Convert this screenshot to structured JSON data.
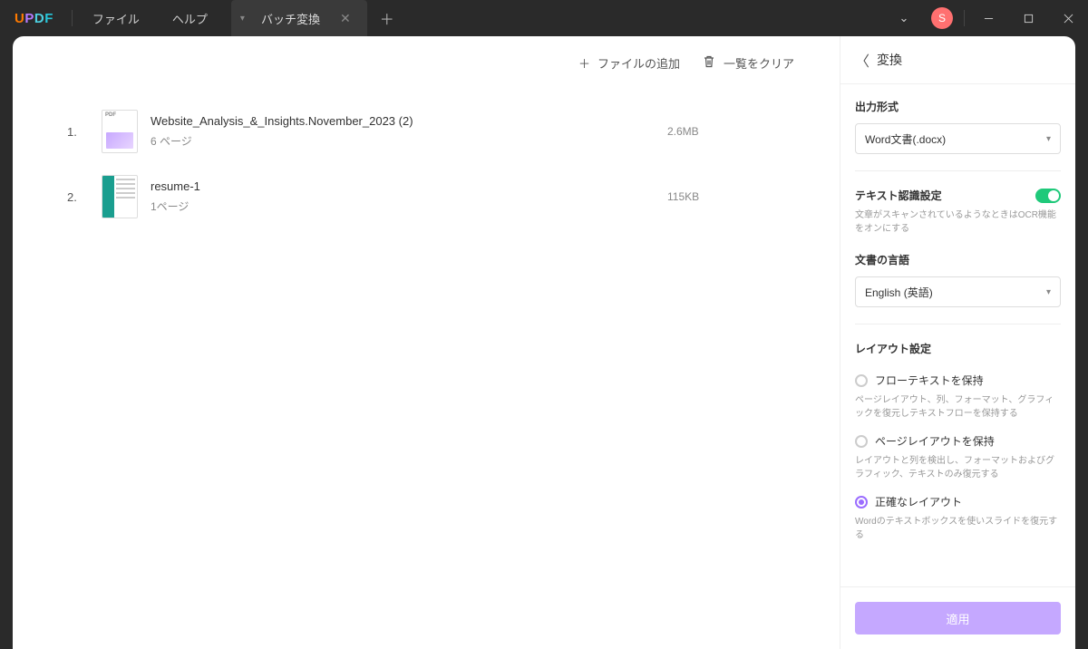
{
  "menu": {
    "file": "ファイル",
    "help": "ヘルプ"
  },
  "tab": {
    "title": "バッチ変換"
  },
  "avatar": "S",
  "toolbar": {
    "add_files": "ファイルの追加",
    "clear_list": "一覧をクリア"
  },
  "files": [
    {
      "idx": "1.",
      "name": "Website_Analysis_&_Insights.November_2023 (2)",
      "pages": "6 ページ",
      "size": "2.6MB"
    },
    {
      "idx": "2.",
      "name": "resume-1",
      "pages": "1ページ",
      "size": "115KB"
    }
  ],
  "sidebar": {
    "title": "変換",
    "output_format_label": "出力形式",
    "output_format_value": "Word文書(.docx)",
    "ocr_label": "テキスト認識設定",
    "ocr_desc": "文章がスキャンされているようなときはOCR機能をオンにする",
    "lang_label": "文書の言語",
    "lang_value": "English (英語)",
    "layout_label": "レイアウト設定",
    "layout_options": [
      {
        "label": "フローテキストを保持",
        "desc": "ページレイアウト、列、フォーマット、グラフィックを復元しテキストフローを保持する",
        "checked": false
      },
      {
        "label": "ページレイアウトを保持",
        "desc": "レイアウトと列を検出し、フォーマットおよびグラフィック、テキストのみ復元する",
        "checked": false
      },
      {
        "label": "正確なレイアウト",
        "desc": "Wordのテキストボックスを使いスライドを復元する",
        "checked": true
      }
    ],
    "apply": "適用"
  }
}
